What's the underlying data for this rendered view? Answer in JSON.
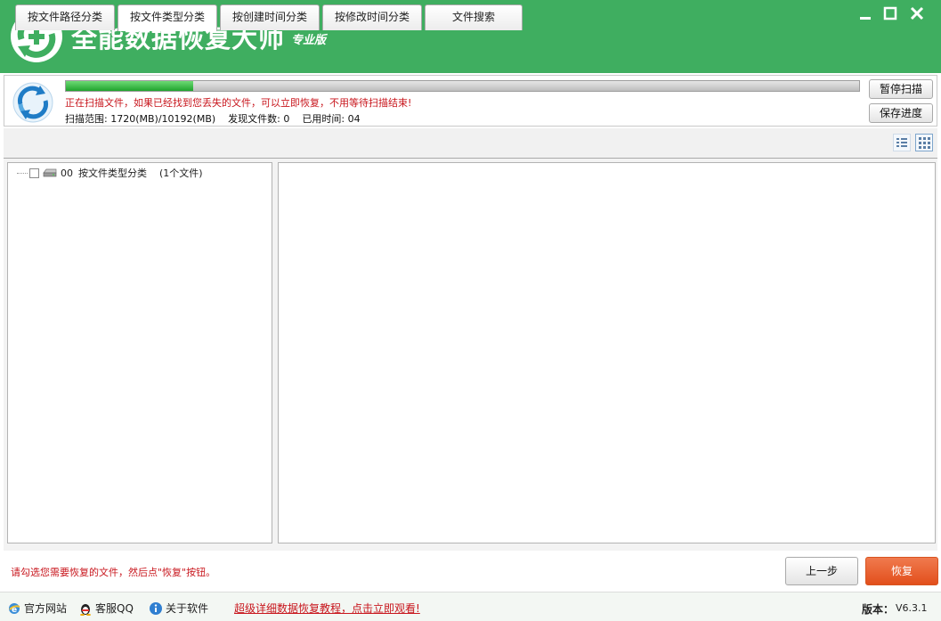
{
  "window": {
    "title": "全能数据恢复大师",
    "edition": "专业版",
    "minimize_label": "–",
    "maximize_label": "☐",
    "close_label": "✕"
  },
  "scan": {
    "progress_fraction": 0.16,
    "message": "正在扫描文件，如果已经找到您丢失的文件，可以立即恢复，不用等待扫描结束!",
    "range_label": "扫描范围:",
    "range_value": "1720(MB)/10192(MB)",
    "found_label": "发现文件数:",
    "found_value": "0",
    "elapsed_label": "已用时间:",
    "elapsed_value": "04",
    "pause_button": "暂停扫描",
    "save_button": "保存进度"
  },
  "tabs": [
    "按文件路径分类",
    "按文件类型分类",
    "按创建时间分类",
    "按修改时间分类",
    "文件搜索"
  ],
  "active_tab": 1,
  "view_icons": [
    "list-view-icon",
    "thumbnail-view-icon"
  ],
  "tree": {
    "root_code": "00",
    "root_label": "按文件类型分类",
    "root_count": "(1个文件)"
  },
  "footer": {
    "hint": "请勾选您需要恢复的文件，然后点\"恢复\"按钮。",
    "prev_button": "上一步",
    "recover_button": "恢复",
    "official_site": "官方网站",
    "support_qq": "客服QQ",
    "about": "关于软件",
    "tutorial_link": "超级详细数据恢复教程，点击立即观看!",
    "version_label": "版本：",
    "version_value": "V6.3.1"
  },
  "colors": {
    "brand_green": "#3fae60",
    "progress_green": "#2fb83a",
    "warning_red": "#c8161d",
    "recover_orange": "#ea5a2a"
  }
}
